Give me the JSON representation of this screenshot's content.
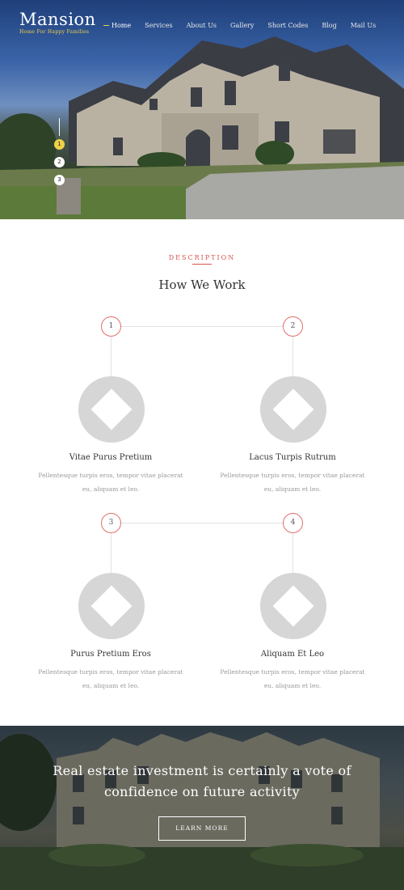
{
  "header": {
    "brand_title": "Mansion",
    "brand_tagline": "Home For Happy Families",
    "nav": [
      "Home",
      "Services",
      "About Us",
      "Gallery",
      "Short Codes",
      "Blog",
      "Mail Us"
    ],
    "active_nav": "Home"
  },
  "hero": {
    "slides": [
      "1",
      "2",
      "3"
    ],
    "active_slide": "1"
  },
  "description": {
    "label": "DESCRIPTION",
    "title": "How We Work",
    "steps": [
      {
        "number": "1",
        "title": "Vitae Purus Pretium",
        "text_line1": "Pellentesque turpis eros, tempor vitae placerat",
        "text_line2": "eu, aliquam et leo."
      },
      {
        "number": "2",
        "title": "Lacus Turpis Rutrum",
        "text_line1": "Pellentesque turpis eros, tempor vitae placerat",
        "text_line2": "eu, aliquam et leo."
      },
      {
        "number": "3",
        "title": "Purus Pretium Eros",
        "text_line1": "Pellentesque turpis eros, tempor vitae placerat",
        "text_line2": "eu, aliquam et leo."
      },
      {
        "number": "4",
        "title": "Aliquam Et Leo",
        "text_line1": "Pellentesque turpis eros, tempor vitae placerat",
        "text_line2": "eu, aliquam et leo."
      }
    ]
  },
  "banner": {
    "line1": "Real estate investment is certainly a vote of",
    "line2": "confidence on future activity",
    "button": "LEARN MORE"
  },
  "colors": {
    "accent_red": "#d9534f",
    "accent_yellow": "#f0d24a",
    "placeholder_gray": "#d6d6d6"
  }
}
